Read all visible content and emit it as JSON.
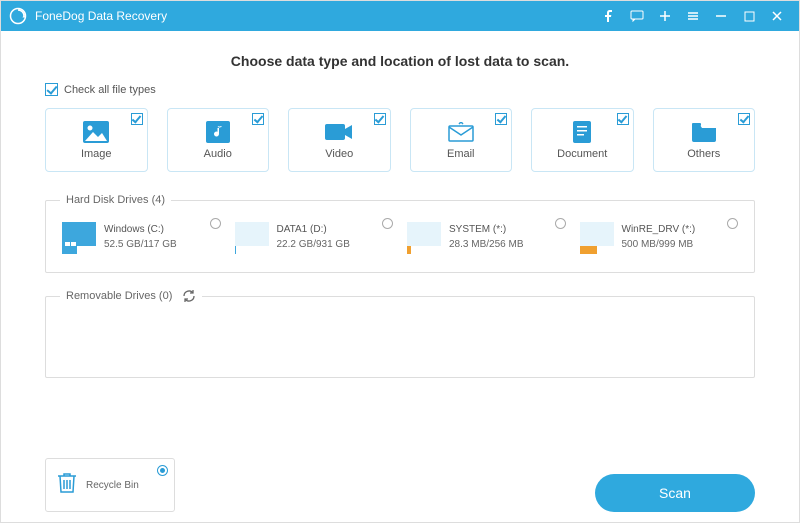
{
  "titlebar": {
    "title": "FoneDog Data Recovery"
  },
  "heading": "Choose data type and location of lost data to scan.",
  "checkAll": {
    "label": "Check all file types",
    "checked": true
  },
  "types": [
    {
      "key": "image",
      "label": "Image"
    },
    {
      "key": "audio",
      "label": "Audio"
    },
    {
      "key": "video",
      "label": "Video"
    },
    {
      "key": "email",
      "label": "Email"
    },
    {
      "key": "document",
      "label": "Document"
    },
    {
      "key": "others",
      "label": "Others"
    }
  ],
  "hdd": {
    "legend": "Hard Disk Drives (4)",
    "drives": [
      {
        "name": "Windows (C:)",
        "size": "52.5 GB/117 GB",
        "barColor": "#3da7dd",
        "barPct": 45,
        "os": true
      },
      {
        "name": "DATA1 (D:)",
        "size": "22.2 GB/931 GB",
        "barColor": "#3da7dd",
        "barPct": 3
      },
      {
        "name": "SYSTEM (*:)",
        "size": "28.3 MB/256 MB",
        "barColor": "#f0a030",
        "barPct": 12
      },
      {
        "name": "WinRE_DRV (*:)",
        "size": "500 MB/999 MB",
        "barColor": "#f0a030",
        "barPct": 50
      }
    ]
  },
  "removable": {
    "legend": "Removable Drives (0)"
  },
  "recycle": {
    "label": "Recycle Bin",
    "selected": true
  },
  "scan": {
    "label": "Scan"
  }
}
